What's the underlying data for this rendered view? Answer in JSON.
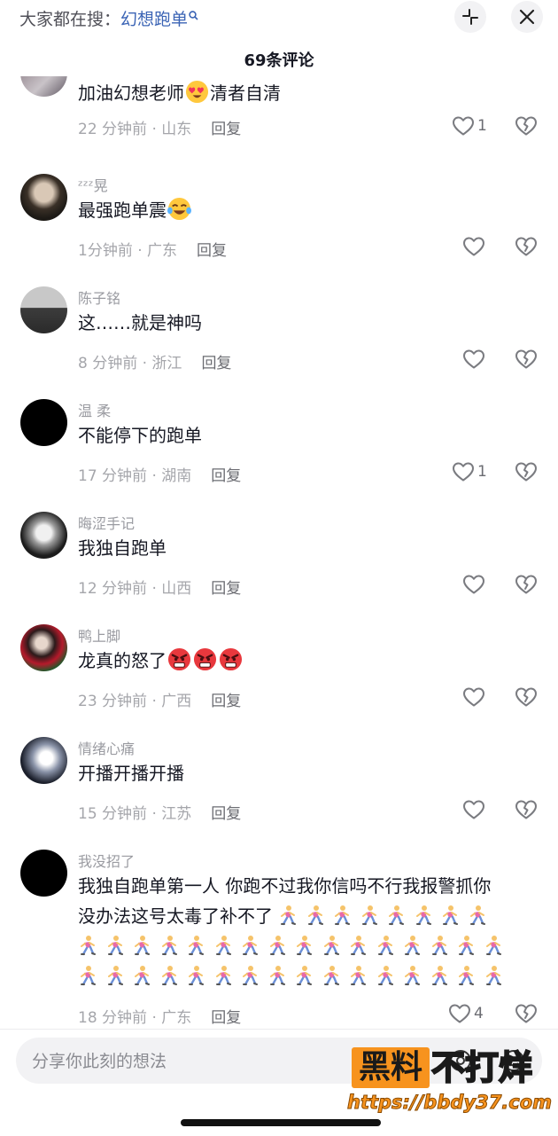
{
  "header": {
    "search_prefix": "大家都在搜：",
    "search_term": "幻想跑单",
    "search_icon": "search-icon",
    "collapse_icon": "collapse-icon",
    "close_icon": "close-icon",
    "comment_count": "69条评论"
  },
  "comments": [
    {
      "username": "",
      "text": "加油幻想老师",
      "text_tail": "清者自清",
      "emoji": "heart-eyes-emoji",
      "time_location": "22 分钟前 · 山东",
      "reply": "回复",
      "likes": "1",
      "avatar": "avatar-photo"
    },
    {
      "username": "ᶻᶻᶻ晃",
      "text": "最强跑单震",
      "emoji": "crying-laughing-emoji",
      "time_location": "1分钟前 · 广东",
      "reply": "回复",
      "likes": "",
      "avatar": "avatar-photo"
    },
    {
      "username": "陈子铭",
      "text": "这……就是神吗",
      "time_location": "8 分钟前 · 浙江",
      "reply": "回复",
      "likes": "",
      "avatar": "avatar-photo"
    },
    {
      "username": "温 柔",
      "text": "不能停下的跑单",
      "time_location": "17 分钟前 · 湖南",
      "reply": "回复",
      "likes": "1",
      "avatar": "avatar-black"
    },
    {
      "username": "晦涩手记",
      "text": "我独自跑单",
      "time_location": "12 分钟前 · 山西",
      "reply": "回复",
      "likes": "",
      "avatar": "avatar-photo"
    },
    {
      "username": "鸭上脚",
      "text": "龙真的怒了",
      "emoji": "angry-face-emoji",
      "time_location": "23 分钟前 · 广西",
      "reply": "回复",
      "likes": "",
      "avatar": "avatar-photo"
    },
    {
      "username": "情绪心痛",
      "text": "开播开播开播",
      "time_location": "15 分钟前 · 江苏",
      "reply": "回复",
      "likes": "",
      "avatar": "avatar-photo"
    },
    {
      "username": "我没招了",
      "text_line1": "我独自跑单第一人 你跑不过我你信吗不行我报警抓你",
      "text_line2": "没办法这号太毒了补不了",
      "emoji": "running-person-emoji",
      "time_location": "18 分钟前 · 广东",
      "reply": "回复",
      "likes": "4",
      "avatar": "avatar-black"
    }
  ],
  "input": {
    "placeholder": "分享你此刻的想法"
  },
  "watermark": {
    "box": "黑料",
    "text": "不打烊",
    "url": "https://bbdy37.com"
  },
  "colors": {
    "accent": "#3b64b5",
    "watermark": "#f7931e"
  }
}
